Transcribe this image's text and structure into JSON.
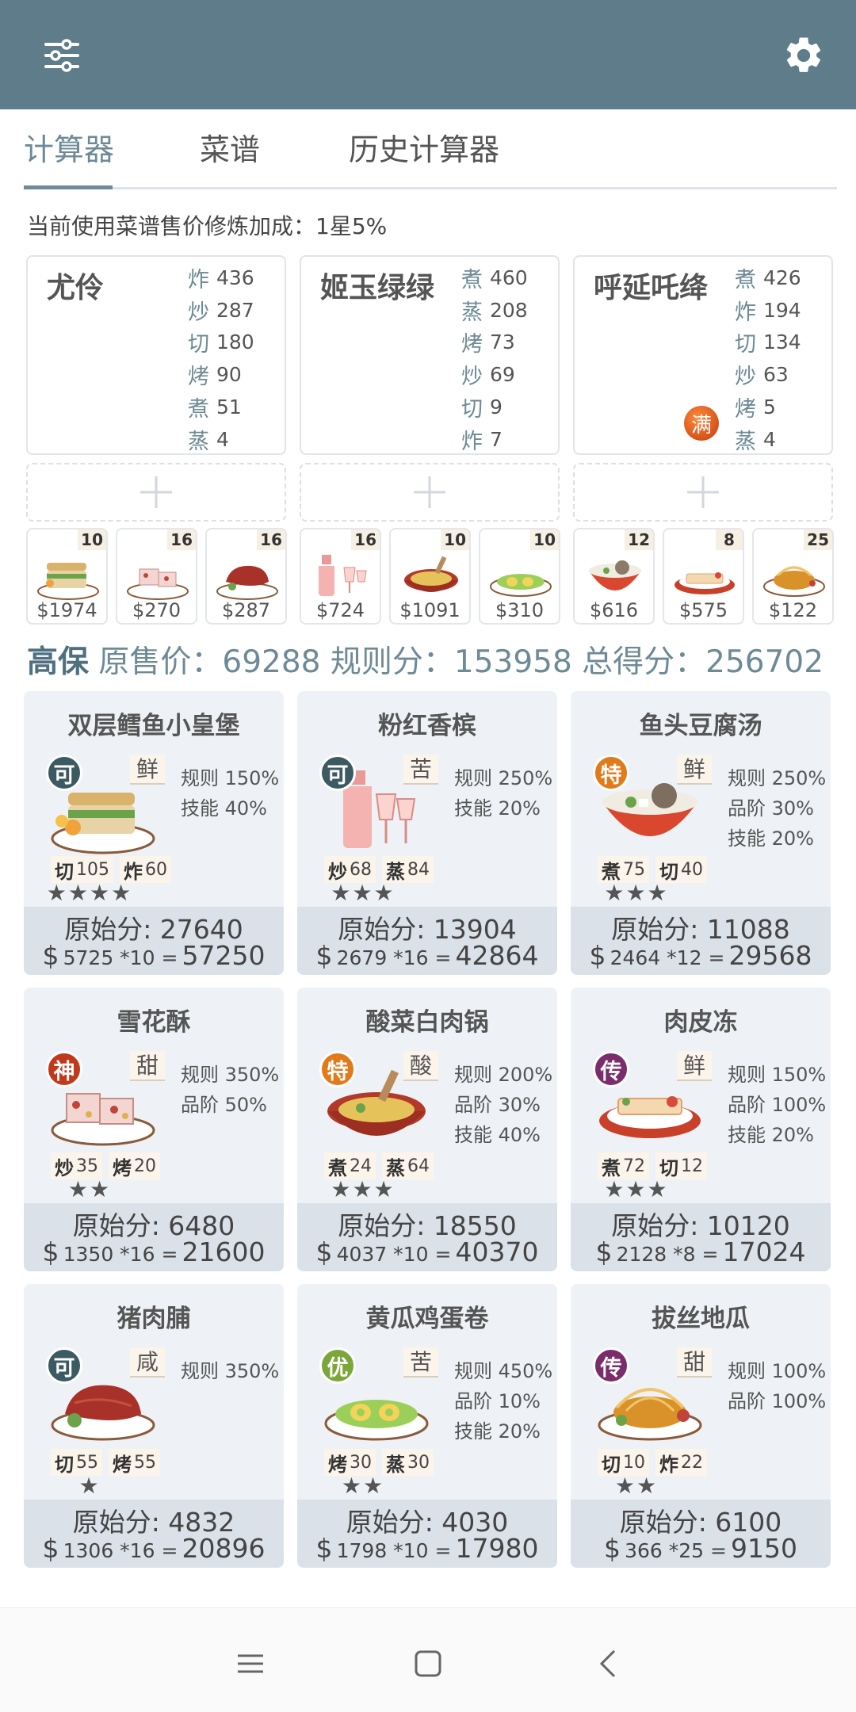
{
  "app": {
    "tabs": [
      {
        "label": "计算器",
        "active": true
      },
      {
        "label": "菜谱",
        "active": false
      },
      {
        "label": "历史计算器",
        "active": false
      }
    ],
    "bonus_line": "当前使用菜谱售价修炼加成：1星5%"
  },
  "colors": {
    "appbar": "#5f7c8a",
    "accent": "#6d8a96"
  },
  "chefs": [
    {
      "name": "尤伶",
      "skills": [
        {
          "icon": "炸",
          "value": "436"
        },
        {
          "icon": "炒",
          "value": "287"
        },
        {
          "icon": "切",
          "value": "180"
        },
        {
          "icon": "烤",
          "value": "90"
        },
        {
          "icon": "煮",
          "value": "51"
        },
        {
          "icon": "蒸",
          "value": "4"
        }
      ]
    },
    {
      "name": "姬玉绿绿",
      "skills": [
        {
          "icon": "煮",
          "value": "460"
        },
        {
          "icon": "蒸",
          "value": "208"
        },
        {
          "icon": "烤",
          "value": "73"
        },
        {
          "icon": "炒",
          "value": "69"
        },
        {
          "icon": "切",
          "value": "9"
        },
        {
          "icon": "炸",
          "value": "7"
        }
      ]
    },
    {
      "name": "呼延吒绛",
      "badge": "满",
      "skills": [
        {
          "icon": "煮",
          "value": "426"
        },
        {
          "icon": "炸",
          "value": "194"
        },
        {
          "icon": "切",
          "value": "134"
        },
        {
          "icon": "炒",
          "value": "63"
        },
        {
          "icon": "烤",
          "value": "5"
        },
        {
          "icon": "蒸",
          "value": "4"
        }
      ]
    }
  ],
  "dishes": [
    {
      "qty": "10",
      "price": "$1974"
    },
    {
      "qty": "16",
      "price": "$270"
    },
    {
      "qty": "16",
      "price": "$287"
    },
    {
      "qty": "16",
      "price": "$724"
    },
    {
      "qty": "10",
      "price": "$1091"
    },
    {
      "qty": "10",
      "price": "$310"
    },
    {
      "qty": "12",
      "price": "$616"
    },
    {
      "qty": "8",
      "price": "$575"
    },
    {
      "qty": "25",
      "price": "$122"
    }
  ],
  "summary": {
    "grade": "高保",
    "text": "原售价：69288 规则分：153958 总得分：256702"
  },
  "recipes": [
    {
      "name": "双层鳕鱼小皇堡",
      "grade": "可",
      "flavor": "鲜",
      "bonus": [
        "规则 150%",
        "技能 40%"
      ],
      "reqs": [
        {
          "k": "切",
          "v": "105"
        },
        {
          "k": "炸",
          "v": "60"
        }
      ],
      "stars": "★★★★",
      "orig": "原始分: 27640",
      "dollar": "$",
      "calc": "5725 *10  =",
      "total": "57250"
    },
    {
      "name": "粉红香槟",
      "grade": "可",
      "flavor": "苦",
      "bonus": [
        "规则 250%",
        "技能 20%"
      ],
      "reqs": [
        {
          "k": "炒",
          "v": "68"
        },
        {
          "k": "蒸",
          "v": "84"
        }
      ],
      "stars": "★★★",
      "orig": "原始分: 13904",
      "dollar": "$",
      "calc": "2679 *16  =",
      "total": "42864"
    },
    {
      "name": "鱼头豆腐汤",
      "grade": "特",
      "flavor": "鲜",
      "bonus": [
        "规则 250%",
        "品阶 30%",
        "技能 20%"
      ],
      "reqs": [
        {
          "k": "煮",
          "v": "75"
        },
        {
          "k": "切",
          "v": "40"
        }
      ],
      "stars": "★★★",
      "orig": "原始分: 11088",
      "dollar": "$",
      "calc": "2464 *12  =",
      "total": "29568"
    },
    {
      "name": "雪花酥",
      "grade": "神",
      "flavor": "甜",
      "bonus": [
        "规则 350%",
        "品阶 50%"
      ],
      "reqs": [
        {
          "k": "炒",
          "v": "35"
        },
        {
          "k": "烤",
          "v": "20"
        }
      ],
      "stars": "★★",
      "orig": "原始分: 6480",
      "dollar": "$",
      "calc": "1350 *16  =",
      "total": "21600"
    },
    {
      "name": "酸菜白肉锅",
      "grade": "特",
      "flavor": "酸",
      "bonus": [
        "规则 200%",
        "品阶 30%",
        "技能 40%"
      ],
      "reqs": [
        {
          "k": "煮",
          "v": "24"
        },
        {
          "k": "蒸",
          "v": "64"
        }
      ],
      "stars": "★★★",
      "orig": "原始分: 18550",
      "dollar": "$",
      "calc": "4037 *10  =",
      "total": "40370"
    },
    {
      "name": "肉皮冻",
      "grade": "传",
      "flavor": "鲜",
      "bonus": [
        "规则 150%",
        "品阶 100%",
        "技能 20%"
      ],
      "reqs": [
        {
          "k": "煮",
          "v": "72"
        },
        {
          "k": "切",
          "v": "12"
        }
      ],
      "stars": "★★★",
      "orig": "原始分: 10120",
      "dollar": "$",
      "calc": "2128 *8  =",
      "total": "17024"
    },
    {
      "name": "猪肉脯",
      "grade": "可",
      "flavor": "咸",
      "bonus": [
        "规则 350%"
      ],
      "reqs": [
        {
          "k": "切",
          "v": "55"
        },
        {
          "k": "烤",
          "v": "55"
        }
      ],
      "stars": "★",
      "orig": "原始分: 4832",
      "dollar": "$",
      "calc": "1306 *16  =",
      "total": "20896"
    },
    {
      "name": "黄瓜鸡蛋卷",
      "grade": "优",
      "flavor": "苦",
      "bonus": [
        "规则 450%",
        "品阶 10%",
        "技能 20%"
      ],
      "reqs": [
        {
          "k": "烤",
          "v": "30"
        },
        {
          "k": "蒸",
          "v": "30"
        }
      ],
      "stars": "★★",
      "orig": "原始分: 4030",
      "dollar": "$",
      "calc": "1798 *10  =",
      "total": "17980"
    },
    {
      "name": "拔丝地瓜",
      "grade": "传",
      "flavor": "甜",
      "bonus": [
        "规则 100%",
        "品阶 100%"
      ],
      "reqs": [
        {
          "k": "切",
          "v": "10"
        },
        {
          "k": "炸",
          "v": "22"
        }
      ],
      "stars": "★★",
      "orig": "原始分: 6100",
      "dollar": "$",
      "calc": "366 *25  =",
      "total": "9150"
    }
  ]
}
